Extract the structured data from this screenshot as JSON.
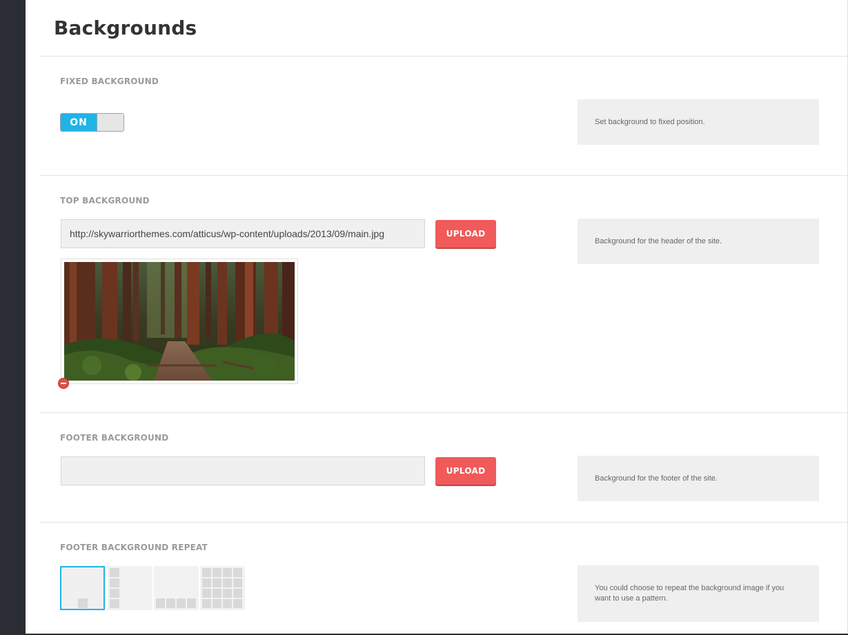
{
  "page": {
    "title": "Backgrounds"
  },
  "sections": {
    "fixed_background": {
      "label": "FIXED BACKGROUND",
      "toggle": {
        "on_label": "ON",
        "state": "on",
        "accent_color": "#1eb4e6"
      },
      "description": "Set background to fixed position."
    },
    "top_background": {
      "label": "TOP BACKGROUND",
      "input_value": "http://skywarriorthemes.com/atticus/wp-content/uploads/2013/09/main.jpg",
      "upload_label": "UPLOAD",
      "description": "Background for the header of the site.",
      "preview_icon": "forest-image",
      "remove_icon": "remove-icon"
    },
    "footer_background": {
      "label": "FOOTER BACKGROUND",
      "input_value": "",
      "upload_label": "UPLOAD",
      "description": "Background for the footer of the site."
    },
    "footer_background_repeat": {
      "label": "FOOTER BACKGROUND REPEAT",
      "options": [
        "no-repeat",
        "repeat-y",
        "repeat-x",
        "repeat"
      ],
      "selected": "no-repeat",
      "description": "You could choose to repeat the background image if you want to use a pattern."
    }
  },
  "colors": {
    "accent": "#1eb4e6",
    "upload_button": "#f05a5a",
    "sidebar": "#2a2d33"
  }
}
